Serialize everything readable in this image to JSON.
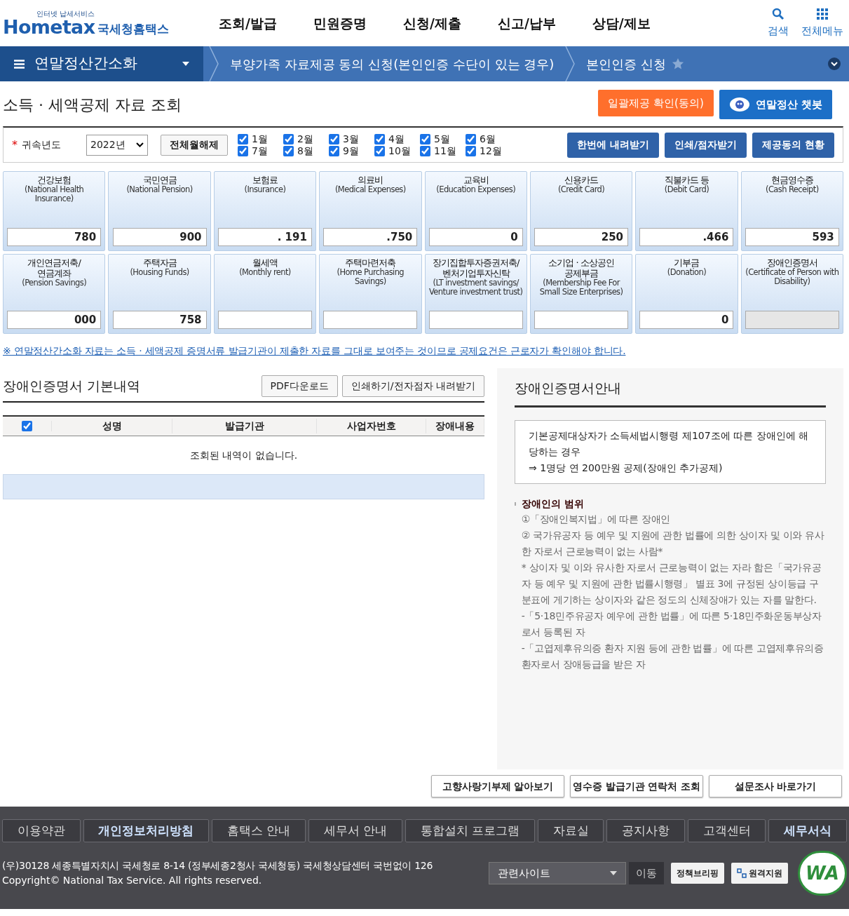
{
  "header": {
    "logo": {
      "tagline": "인터넷 납세서비스",
      "name": "Hometax",
      "org": "국세청홈택스"
    },
    "nav": [
      "조회/발급",
      "민원증명",
      "신청/제출",
      "신고/납부",
      "상담/제보"
    ],
    "actions": [
      {
        "kind": "search",
        "label": "검색"
      },
      {
        "kind": "menu",
        "label": "전체메뉴"
      }
    ]
  },
  "breadcrumb": {
    "menu": "연말정산간소화",
    "items": [
      "부양가족 자료제공 동의 신청(본인인증 수단이 있는 경우)",
      "본인인증 신청"
    ]
  },
  "page_title": "소득 · 세액공제 자료 조회",
  "top_buttons": [
    {
      "kind": "orange",
      "label": "일괄제공 확인(동의)"
    },
    {
      "kind": "chatbot",
      "label": "연말정산 챗봇"
    }
  ],
  "filter": {
    "required_mark": "*",
    "label": "귀속년도",
    "year": "2022년",
    "clear_button": "전체월해제",
    "months": [
      {
        "label": "1월",
        "checked": true
      },
      {
        "label": "2월",
        "checked": true
      },
      {
        "label": "3월",
        "checked": true
      },
      {
        "label": "4월",
        "checked": true
      },
      {
        "label": "5월",
        "checked": true
      },
      {
        "label": "6월",
        "checked": true
      },
      {
        "label": "7월",
        "checked": true
      },
      {
        "label": "8월",
        "checked": true
      },
      {
        "label": "9월",
        "checked": true
      },
      {
        "label": "10월",
        "checked": true
      },
      {
        "label": "11월",
        "checked": true
      },
      {
        "label": "12월",
        "checked": true
      }
    ],
    "buttons": [
      "한번에 내려받기",
      "인쇄/점자받기",
      "제공동의 현황"
    ]
  },
  "cards": [
    {
      "title": "건강보험",
      "subtitle": "(National Health Insurance)",
      "value": "780",
      "disabled": false
    },
    {
      "title": "국민연금",
      "subtitle": "(National Pension)",
      "value": "900",
      "disabled": false
    },
    {
      "title": "보험료",
      "subtitle": "(Insurance)",
      "value": ".  191",
      "disabled": false
    },
    {
      "title": "의료비",
      "subtitle": "(Medical Expenses)",
      "value": ".750",
      "disabled": false
    },
    {
      "title": "교육비",
      "subtitle": "(Education Expenses)",
      "value": "0",
      "disabled": false
    },
    {
      "title": "신용카드",
      "subtitle": "(Credit Card)",
      "value": "250",
      "disabled": false
    },
    {
      "title": "직불카드 등",
      "subtitle": "(Debit Card)",
      "value": ".466",
      "disabled": false
    },
    {
      "title": "현금영수증",
      "subtitle": "(Cash Receipt)",
      "value": "593",
      "disabled": false
    },
    {
      "title": "개인연금저축/\n연금계좌",
      "subtitle": "(Pension Savings)",
      "value": "000",
      "disabled": false
    },
    {
      "title": "주택자금",
      "subtitle": "(Housing Funds)",
      "value": "758",
      "disabled": false
    },
    {
      "title": "월세액",
      "subtitle": "(Monthly rent)",
      "disabled": false
    },
    {
      "title": "주택마련저축",
      "subtitle": "(Home Purchasing Savings)",
      "disabled": false
    },
    {
      "title": "장기집합투자증권저축/\n벤처기업투자신탁",
      "subtitle": "(LT investment savings/ Venture investment trust)",
      "disabled": false
    },
    {
      "title": "소기업 · 소상공인\n공제부금",
      "subtitle": "(Membership Fee For Small Size Enterprises)",
      "disabled": false
    },
    {
      "title": "기부금",
      "subtitle": "(Donation)",
      "value": "0",
      "disabled": false
    },
    {
      "title": "장애인증명서",
      "subtitle": "(Certificate of Person with Disability)",
      "disabled": true
    }
  ],
  "notice": "※ 연말정산간소화 자료는 소득 · 세액공제 증명서류 발급기관이 제출한 자료를 그대로 보여주는 것이므로 공제요건은 근로자가 확인해야 합니다.",
  "detail": {
    "title": "장애인증명서 기본내역",
    "buttons": [
      "PDF다운로드",
      "인쇄하기/전자점자 내려받기"
    ],
    "table": {
      "select_all_checked": true,
      "columns": [
        "성명",
        "발급기관",
        "사업자번호",
        "장애내용"
      ],
      "empty_message": "조회된 내역이 없습니다."
    }
  },
  "guide": {
    "title": "장애인증명서안내",
    "box_lines": [
      "기본공제대상자가 소득세법시행령 제107조에 따른 장애인에 해당하는 경우",
      "⇒ 1명당 연 200만원 공제(장애인 추가공제)"
    ],
    "section": "장애인의 범위",
    "lines": [
      "①「장애인복지법」에 따른 장애인",
      "② 국가유공자 등 예우 및 지원에 관한 법률에 의한 상이자 및 이와 유사한 자로서 근로능력이 없는 사람*",
      "* 상이자 및 이와 유사한 자로서 근로능력이 없는 자라 함은「국가유공자 등 예우 및 지원에 관한 법률시행령」 별표 3에 규정된 상이등급 구분표에 게기하는 상이자와 같은 정도의 신체장애가 있는 자를 말한다.",
      "-「5·18민주유공자 예우에 관한 법률」에 따른 5·18민주화운동부상자로서 등록된 자",
      "-「고엽제후유의증 환자 지원 등에 관한 법률」에 따른 고엽제후유의증환자로서 장애등급을 받은 자"
    ]
  },
  "bottom_buttons": [
    "고향사랑기부제 알아보기",
    "영수증 발급기관 연락처 조회",
    "설문조사 바로가기"
  ],
  "footer": {
    "links": [
      {
        "label": "이용약관",
        "highlighted": false
      },
      {
        "label": "개인정보처리방침",
        "highlighted": true
      },
      {
        "label": "홈택스 안내",
        "highlighted": false
      },
      {
        "label": "세무서 안내",
        "highlighted": false
      },
      {
        "label": "통합설치 프로그램",
        "highlighted": false
      },
      {
        "label": "자료실",
        "highlighted": false
      },
      {
        "label": "공지사항",
        "highlighted": false
      },
      {
        "label": "고객센터",
        "highlighted": false
      },
      {
        "label": "세무서식",
        "highlighted": true
      }
    ],
    "address": "(우)30128 세종특별자치시 국세청로 8-14 (정부세종2청사 국세청동) 국세청상담센터 국번없이 126",
    "copyright": "Copyright© National Tax Service. All rights reserved.",
    "site_select": "관련사이트",
    "go_button": "이동",
    "badges": [
      {
        "kind": "briefing",
        "label": "정책브리핑"
      },
      {
        "kind": "remote",
        "label": "원격지원"
      }
    ],
    "wa_mark": "WA"
  }
}
